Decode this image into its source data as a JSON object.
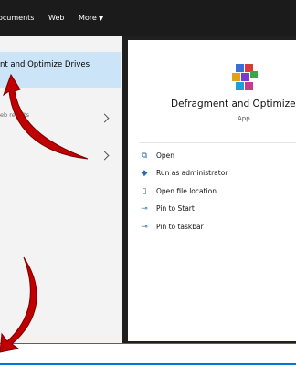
{
  "topbar": {
    "tabs": [
      {
        "label": "ocuments"
      },
      {
        "label": "Web"
      },
      {
        "label": "More"
      }
    ]
  },
  "left": {
    "best_match_title": "nt and Optimize Drives",
    "web_results_label": "eb results"
  },
  "right": {
    "app_name": "Defragment and Optimize D",
    "app_type": "App",
    "actions": [
      {
        "label": "Open",
        "icon": "open-icon"
      },
      {
        "label": "Run as administrator",
        "icon": "shield-icon"
      },
      {
        "label": "Open file location",
        "icon": "file-icon"
      },
      {
        "label": "Pin to Start",
        "icon": "pin-icon"
      },
      {
        "label": "Pin to taskbar",
        "icon": "pin-icon"
      }
    ]
  },
  "search": {
    "value": ""
  },
  "colors": {
    "accent": "#0078d4",
    "selection": "#cce4f7",
    "annotation_arrow": "#c00000"
  }
}
